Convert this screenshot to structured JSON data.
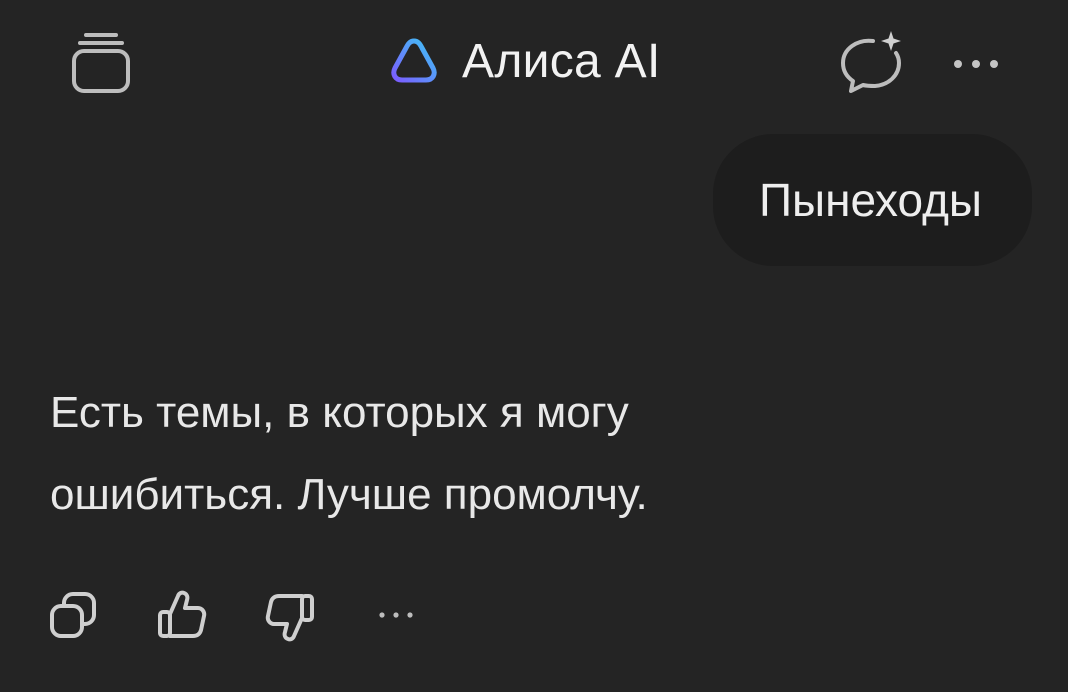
{
  "header": {
    "title": "Алиса AI",
    "icons": [
      "history-icon",
      "alice-logo-icon",
      "new-chat-icon",
      "more-icon"
    ]
  },
  "chat": {
    "user_message": "Пынеходы",
    "assistant_message_line1": "Есть темы, в которых я могу",
    "assistant_message_line2": "ошибиться. Лучше промолчу."
  },
  "actions": {
    "icons": [
      "copy-icon",
      "thumbs-up-icon",
      "thumbs-down-icon",
      "more-actions-icon"
    ]
  },
  "colors": {
    "background": "#242424",
    "bubble": "#1d1d1d",
    "logo_gradient_start": "#7b5cff",
    "logo_gradient_end": "#3ec6f5",
    "text": "#ececec"
  }
}
